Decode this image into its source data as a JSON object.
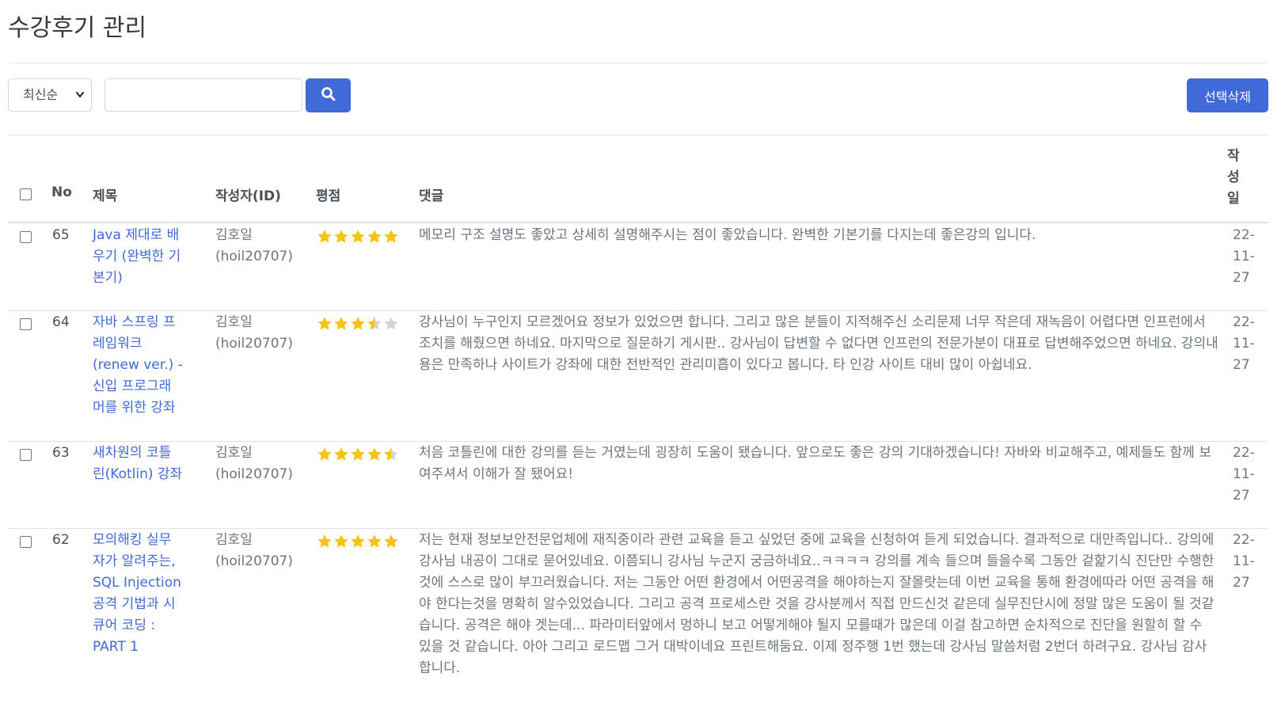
{
  "page": {
    "title": "수강후기 관리"
  },
  "toolbar": {
    "sort_selected": "최신순",
    "search_placeholder": "",
    "delete_label": "선택삭제"
  },
  "table": {
    "headers": {
      "no": "No",
      "title": "제목",
      "author": "작성자(ID)",
      "rating": "평점",
      "comment": "댓글",
      "date": "작\n성\n일"
    },
    "rows": [
      {
        "no": "65",
        "title": "Java 제대로 배우기 (완벽한 기본기)",
        "author": "김호일 (hoil20707)",
        "rating": 5,
        "comment": "메모리 구조 설명도 좋았고 상세히 설명해주시는 점이 좋았습니다. 완벽한 기본기를 다지는데 좋은강의 입니다.",
        "date": "22-11-27"
      },
      {
        "no": "64",
        "title": "자바 스프링 프레임워크(renew ver.) - 신입 프로그래머를 위한 강좌",
        "author": "김호일 (hoil20707)",
        "rating": 3.5,
        "comment": "강사님이 누구인지 모르겠어요 정보가 있었으면 합니다. 그리고 많은 분들이 지적해주신 소리문제 너무 작은데 재녹음이 어렵다면 인프런에서 조치를 해줬으면 하네요. 마지막으로 질문하기 게시판.. 강사님이 답변할 수 없다면 인프런의 전문가분이 대표로 답변해주었으면 하네요. 강의내용은 만족하나 사이트가 강좌에 대한 전반적인 관리미흡이 있다고 봅니다. 타 인강 사이트 대비 많이 아쉽네요.",
        "date": "22-11-27"
      },
      {
        "no": "63",
        "title": "새차원의 코틀린(Kotlin) 강좌",
        "author": "김호일 (hoil20707)",
        "rating": 4.5,
        "comment": "처음 코틀린에 대한 강의를 듣는 거였는데 굉장히 도움이 됐습니다. 앞으로도 좋은 강의 기대하겠습니다! 자바와 비교해주고, 예제들도 함께 보여주셔서 이해가 잘 됐어요!",
        "date": "22-11-27"
      },
      {
        "no": "62",
        "title": "모의해킹 실무자가 알려주는, SQL Injection 공격 기법과 시큐어 코딩 : PART 1",
        "author": "김호일 (hoil20707)",
        "rating": 5,
        "comment": "저는 현재 정보보안전문업체에 재직중이라 관련 교육을 듣고 싶었던 중에 교육을 신청하여 듣게 되었습니다. 결과적으로 대만족입니다.. 강의에 강사님 내공이 그대로 묻어있네요. 이쯤되니 강사님 누군지 궁금하네요..ㅋㅋㅋㅋ 강의를 계속 들으며 들을수록 그동안 겉핥기식 진단만 수행한것에 스스로 많이 부끄러웠습니다. 저는 그동안 어떤 환경에서 어떤공격을 해야하는지 잘몰랏는데 이번 교육을 통해 환경에따라 어떤 공격을 해야 한다는것을 명확히 알수있었습니다. 그리고 공격 프로세스란 것을 강사분께서 직접 만드신것 같은데 실무진단시에 정말 많은 도움이 될 것같습니다. 공격은 해야 겟는데... 파라미터앞에서 멍하니 보고 어떻게해야 될지 모를때가 많은데 이걸 참고하면 순차적으로 진단을 원할히 할 수 있을 것 같습니다. 아아 그리고 로드맵 그거 대박이네요 프린트해둠요. 이제 정주행 1번 했는데 강사님 말씀처럼 2번더 하려구요. 강사님 감사합니다.",
        "date": "22-11-27"
      }
    ]
  },
  "colors": {
    "accent": "#3f6ad8",
    "star": "#f7c211",
    "star_empty": "#d4d4d4"
  },
  "icons": {
    "search": "search-icon",
    "sort_chevron": "chevron-down-icon",
    "star": "star-icon"
  }
}
